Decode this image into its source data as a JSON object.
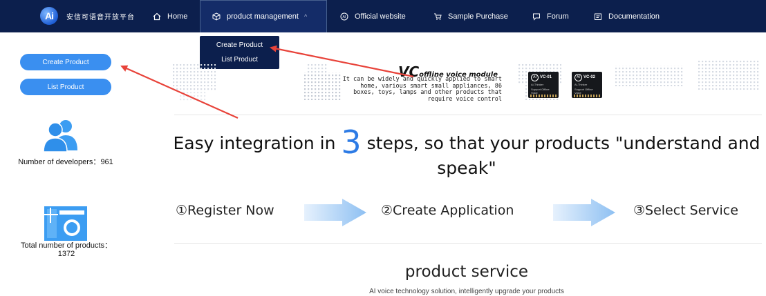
{
  "brand": {
    "logo_text": "Ai",
    "name": "安信可语音开放平台"
  },
  "nav": {
    "home": "Home",
    "product_management": "product management",
    "official_website": "Official website",
    "sample_purchase": "Sample Purchase",
    "forum": "Forum",
    "documentation": "Documentation"
  },
  "dropdown": {
    "create_product": "Create Product",
    "list_product": "List Product"
  },
  "sidebar": {
    "create_product": "Create Product",
    "list_product": "List Product",
    "developers_label": "Number of developers：",
    "developers_count": "961",
    "products_label": "Total number of products：",
    "products_count": "1372"
  },
  "banner": {
    "title_vc": "VC",
    "title_rest": "offline voice module",
    "description": "It can be widely and quickly applied to smart home, various smart small appliances, 86 boxes, toys, lamps and other products that require voice control",
    "chip1": {
      "model": "VC-01",
      "line1": "Ai-Thinker",
      "line2": "Support Offline Voice"
    },
    "chip2": {
      "model": "VC-02",
      "line1": "Ai-Thinker",
      "line2": "Support Offline Voice"
    }
  },
  "headline": {
    "before": "Easy integration in ",
    "number": "3",
    "after": " steps, so that your products \"understand and speak\""
  },
  "steps": [
    "①Register Now",
    "②Create Application",
    "③Select Service"
  ],
  "service": {
    "title": "product service",
    "subtitle": "AI voice technology solution, intelligently upgrade your products"
  },
  "colors": {
    "nav_bg": "#0c1f4d",
    "accent": "#3a8ff0",
    "highlight": "#2d7be5",
    "arrow": "#e8433a"
  }
}
